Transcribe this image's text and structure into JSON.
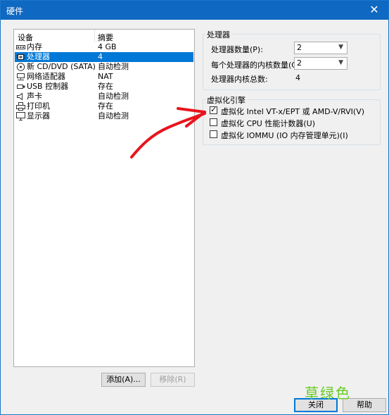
{
  "window": {
    "title": "硬件"
  },
  "device_list": {
    "columns": [
      "设备",
      "摘要"
    ],
    "rows": [
      {
        "icon": "memory-icon",
        "name": "内存",
        "summary": "4 GB"
      },
      {
        "icon": "processor-icon",
        "name": "处理器",
        "summary": "4"
      },
      {
        "icon": "cd-dvd-icon",
        "name": "新 CD/DVD (SATA)",
        "summary": "自动检测"
      },
      {
        "icon": "network-adapter-icon",
        "name": "网络适配器",
        "summary": "NAT"
      },
      {
        "icon": "usb-icon",
        "name": "USB 控制器",
        "summary": "存在"
      },
      {
        "icon": "sound-card-icon",
        "name": "声卡",
        "summary": "自动检测"
      },
      {
        "icon": "printer-icon",
        "name": "打印机",
        "summary": "存在"
      },
      {
        "icon": "display-icon",
        "name": "显示器",
        "summary": "自动检测"
      }
    ]
  },
  "buttons": {
    "add": "添加(A)...",
    "remove": "移除(R)",
    "close": "关闭",
    "help": "帮助"
  },
  "processor": {
    "group_title": "处理器",
    "count_label": "处理器数量(P):",
    "count_value": "2",
    "cores_label": "每个处理器的内核数量(C):",
    "cores_value": "2",
    "total_label": "处理器内核总数:",
    "total_value": "4"
  },
  "virtualization": {
    "group_title": "虚拟化引擎",
    "options": [
      {
        "label": "虚拟化 Intel VT-x/EPT 或 AMD-V/RVI(V)",
        "checked": true
      },
      {
        "label": "虚拟化 CPU 性能计数器(U)",
        "checked": false
      },
      {
        "label": "虚拟化 IOMMU (IO 内存管理单元)(I)",
        "checked": false
      }
    ]
  },
  "overlay": {
    "watermark": "草绿色",
    "arrow_color": "#e8141c"
  },
  "colors": {
    "titlebar": "#0f68c2",
    "selection": "#0078d7"
  }
}
